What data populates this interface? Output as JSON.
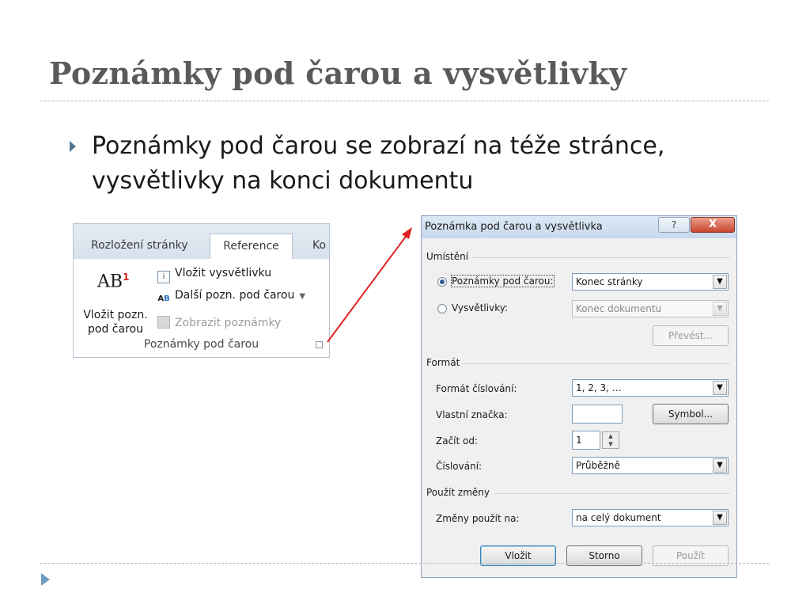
{
  "slide": {
    "title": "Poznámky pod čarou a vysvětlivky",
    "bullet": "Poznámky pod čarou se zobrazí na téže stránce, vysvětlivky na konci dokumentu"
  },
  "ribbon": {
    "tabs": [
      "Rozložení stránky",
      "Reference",
      "Ko"
    ],
    "active_tab": "Reference",
    "big_button_icon": "AB",
    "big_button_icon_sup": "1",
    "big_button_label": "Vložit pozn. pod čarou",
    "items": [
      {
        "icon": "insert-endnote-icon",
        "label": "Vložit vysvětlivku"
      },
      {
        "icon": "next-footnote-icon",
        "label": "Další pozn. pod čarou",
        "has_dropdown": true
      },
      {
        "icon": "show-notes-icon",
        "label": "Zobrazit poznámky",
        "disabled": true
      }
    ],
    "group_label": "Poznámky pod čarou"
  },
  "dialog": {
    "title": "Poznámka pod čarou a vysvětlivka",
    "help_label": "?",
    "close_label": "X",
    "sections": {
      "location": "Umístění",
      "format": "Formát",
      "apply": "Použít změny"
    },
    "location": {
      "footnotes_label": "Poznámky pod čarou:",
      "footnotes_value": "Konec stránky",
      "footnotes_selected": true,
      "endnotes_label": "Vysvětlivky:",
      "endnotes_value": "Konec dokumentu",
      "convert_label": "Převést..."
    },
    "format": {
      "number_format_label": "Formát číslování:",
      "number_format_value": "1, 2, 3, …",
      "custom_mark_label": "Vlastní značka:",
      "custom_mark_value": "",
      "symbol_label": "Symbol...",
      "start_at_label": "Začít od:",
      "start_at_value": "1",
      "numbering_label": "Číslování:",
      "numbering_value": "Průběžně"
    },
    "apply": {
      "apply_to_label": "Změny použít na:",
      "apply_to_value": "na celý dokument"
    },
    "buttons": {
      "insert": "Vložit",
      "cancel": "Storno",
      "apply": "Použít"
    }
  },
  "colors": {
    "title": "#5a5a5a",
    "bullet": "#53758f",
    "arrow": "#e02020",
    "close_button": "#c9452e"
  }
}
